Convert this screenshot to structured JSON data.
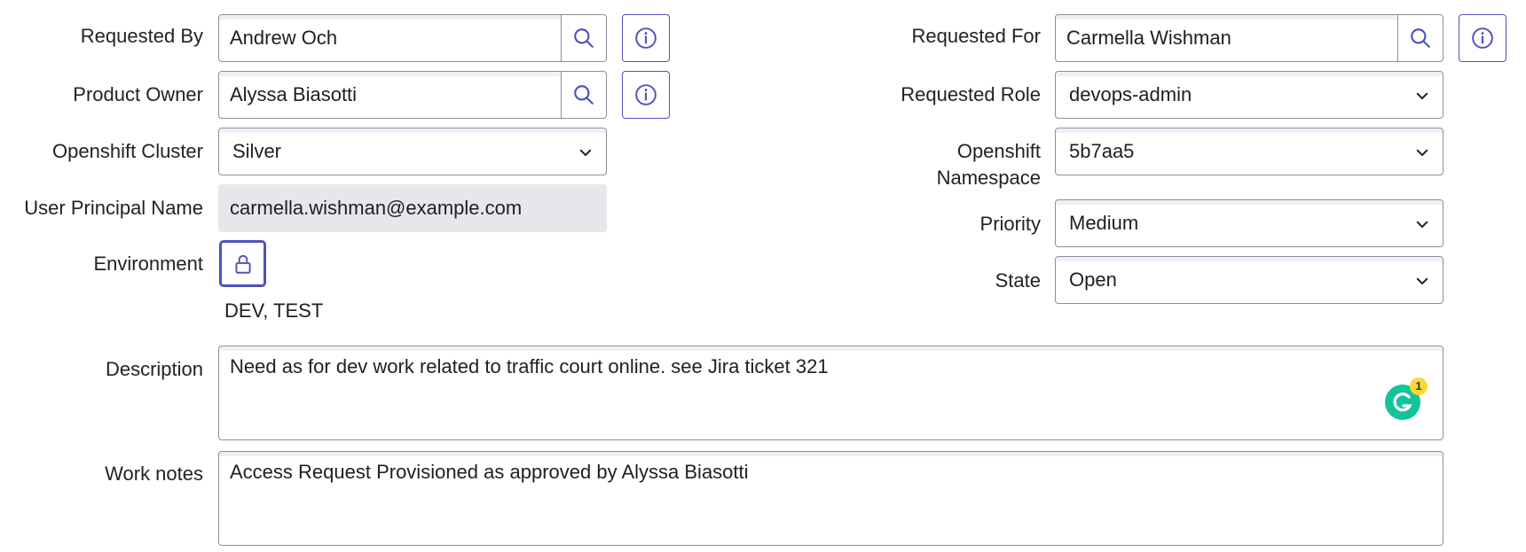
{
  "left": {
    "requested_by": {
      "label": "Requested By",
      "value": "Andrew Och"
    },
    "product_owner": {
      "label": "Product Owner",
      "value": "Alyssa Biasotti"
    },
    "openshift_cluster": {
      "label": "Openshift Cluster",
      "value": "Silver"
    },
    "user_principal_name": {
      "label": "User Principal Name",
      "value": "carmella.wishman@example.com"
    },
    "environment": {
      "label": "Environment",
      "value": "DEV, TEST"
    }
  },
  "right": {
    "requested_for": {
      "label": "Requested For",
      "value": "Carmella Wishman"
    },
    "requested_role": {
      "label": "Requested Role",
      "value": "devops-admin"
    },
    "openshift_namespace": {
      "label_line1": "Openshift",
      "label_line2": "Namespace",
      "value": "5b7aa5"
    },
    "priority": {
      "label": "Priority",
      "value": "Medium"
    },
    "state": {
      "label": "State",
      "value": "Open"
    }
  },
  "description": {
    "label": "Description",
    "value": "Need as for dev work related to traffic court online. see Jira ticket 321"
  },
  "work_notes": {
    "label": "Work notes",
    "value": "Access Request Provisioned as approved by Alyssa Biasotti"
  },
  "grammarly": {
    "badge_count": "1",
    "icon": "grammarly-icon"
  },
  "icons": {
    "lookup": "search-icon",
    "info": "info-icon",
    "lock": "lock-icon",
    "dropdown": "chevron-down-icon"
  },
  "colors": {
    "accent": "#4f52bd",
    "border": "#8a8f9c",
    "readonly_bg": "#e6e7ea",
    "grammarly": "#15c39a"
  }
}
